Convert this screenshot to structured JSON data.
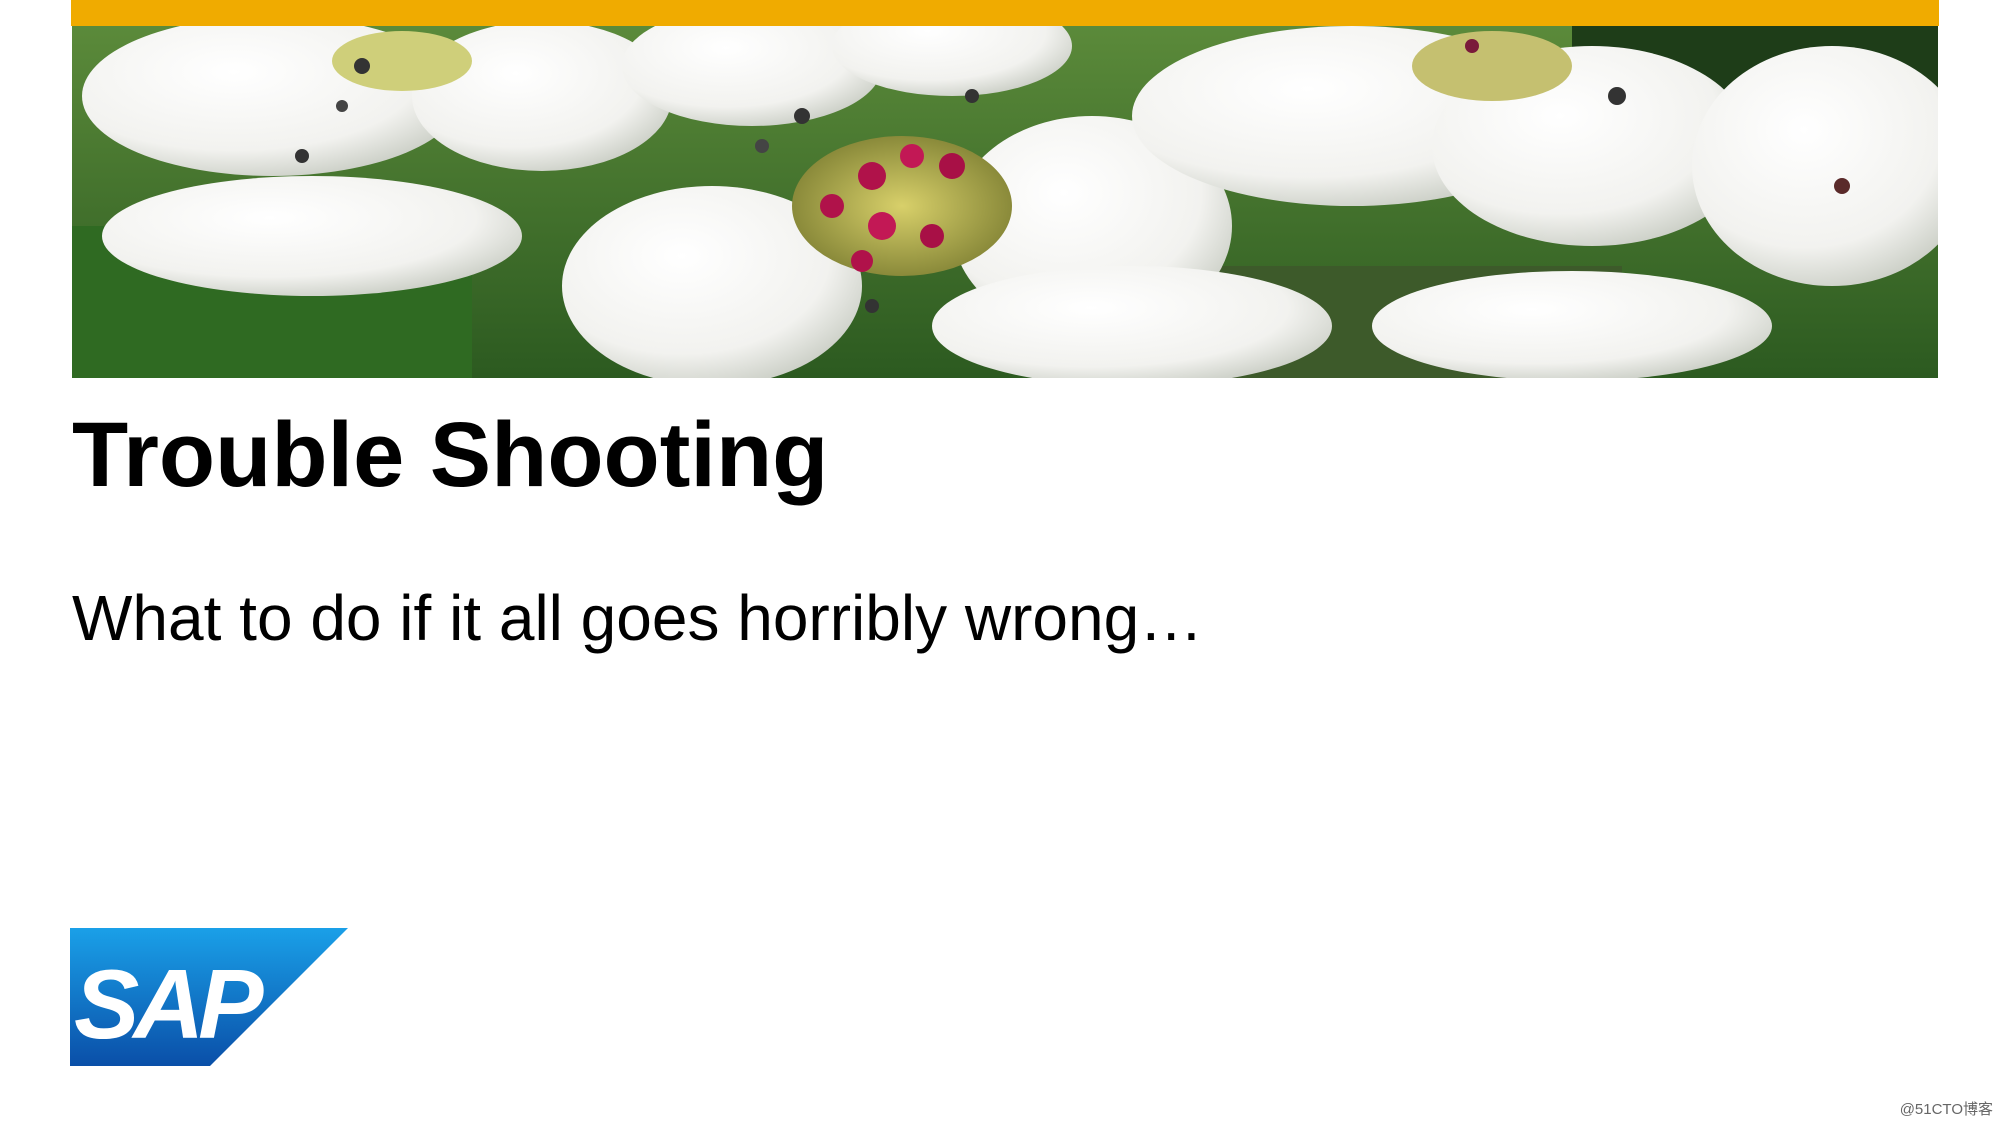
{
  "slide": {
    "title": "Trouble Shooting",
    "subtitle": "What to do if it all goes horribly wrong…"
  },
  "banner": {
    "image": "white-blossom-photo"
  },
  "logo": {
    "text": "SAP",
    "registered_mark": "®"
  },
  "watermark": {
    "text": "@51CTO博客"
  },
  "colors": {
    "accent_bar": "#f0ab00",
    "logo_blue_light": "#1aa0e8",
    "logo_blue_dark": "#0a4fa8",
    "text": "#000000"
  }
}
